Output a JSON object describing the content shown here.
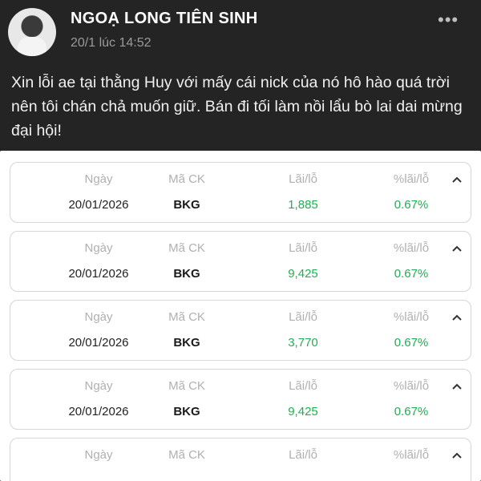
{
  "post": {
    "author": "NGOẠ LONG TIÊN SINH",
    "meta": "20/1 lúc 14:52",
    "more_icon": "more-horizontal-icon",
    "text": "Xin lỗi ae tại thằng Huy với mấy cái nick của nó hô hào quá trời nên tôi chán chả muốn giữ. Bán đi tối làm nồi lẩu bò lai dai mừng đại hội!"
  },
  "columns": {
    "date": "Ngày",
    "code": "Mã CK",
    "pnl": "Lãi/lỗ",
    "pnl_pct": "%lãi/lỗ"
  },
  "colors": {
    "profit_green": "#1fae55"
  },
  "rows": [
    {
      "date": "20/01/2026",
      "code": "BKG",
      "pnl": "1,885",
      "pnl_pct": "0.67%"
    },
    {
      "date": "20/01/2026",
      "code": "BKG",
      "pnl": "9,425",
      "pnl_pct": "0.67%"
    },
    {
      "date": "20/01/2026",
      "code": "BKG",
      "pnl": "3,770",
      "pnl_pct": "0.67%"
    },
    {
      "date": "20/01/2026",
      "code": "BKG",
      "pnl": "9,425",
      "pnl_pct": "0.67%"
    },
    {
      "date": "",
      "code": "",
      "pnl": "",
      "pnl_pct": ""
    }
  ]
}
